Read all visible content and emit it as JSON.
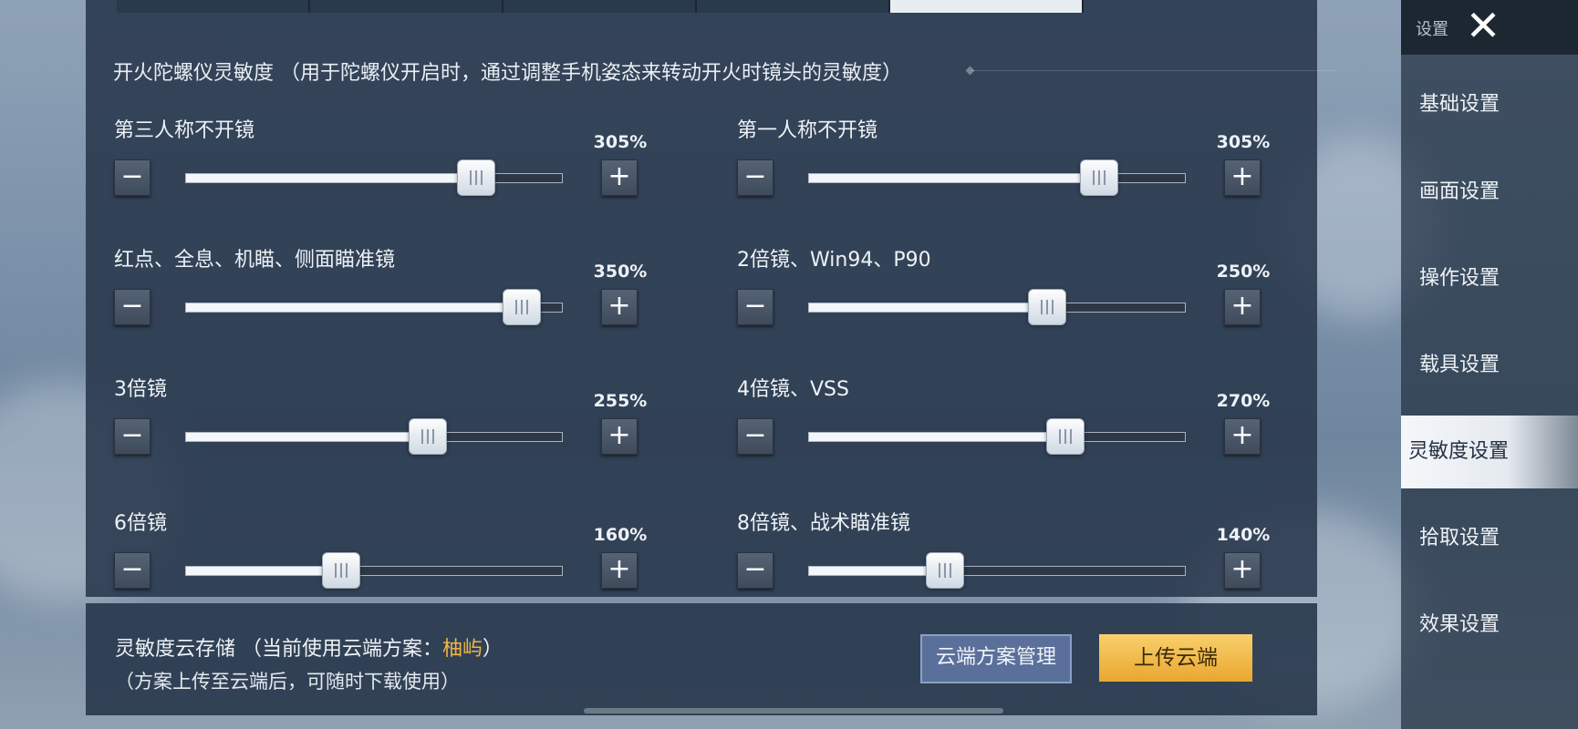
{
  "section_title": "开火陀螺仪灵敏度 （用于陀螺仪开启时，通过调整手机姿态来转动开火时镜头的灵敏度）",
  "sliders": [
    {
      "label": "第三人称不开镜",
      "value_text": "305%",
      "position": 0.77
    },
    {
      "label": "第一人称不开镜",
      "value_text": "305%",
      "position": 0.77
    },
    {
      "label": "红点、全息、机瞄、侧面瞄准镜",
      "value_text": "350%",
      "position": 0.89
    },
    {
      "label": "2倍镜、Win94、P90",
      "value_text": "250%",
      "position": 0.63
    },
    {
      "label": "3倍镜",
      "value_text": "255%",
      "position": 0.64
    },
    {
      "label": "4倍镜、VSS",
      "value_text": "270%",
      "position": 0.68
    },
    {
      "label": "6倍镜",
      "value_text": "160%",
      "position": 0.41
    },
    {
      "label": "8倍镜、战术瞄准镜",
      "value_text": "140%",
      "position": 0.36
    }
  ],
  "stepper": {
    "minus": "−",
    "plus": "+"
  },
  "cloud": {
    "title_prefix": "灵敏度云存储 （当前使用云端方案：",
    "scheme_name": "柚屿",
    "title_suffix": "）",
    "subtitle": "（方案上传至云端后，可随时下载使用）",
    "manage_label": "云端方案管理",
    "upload_label": "上传云端"
  },
  "sidebar": {
    "title": "设置",
    "close": "✕",
    "items": [
      {
        "label": "基础设置"
      },
      {
        "label": "画面设置"
      },
      {
        "label": "操作设置"
      },
      {
        "label": "载具设置"
      },
      {
        "label": "灵敏度设置"
      },
      {
        "label": "拾取设置"
      },
      {
        "label": "效果设置"
      }
    ],
    "active_index": 4
  }
}
